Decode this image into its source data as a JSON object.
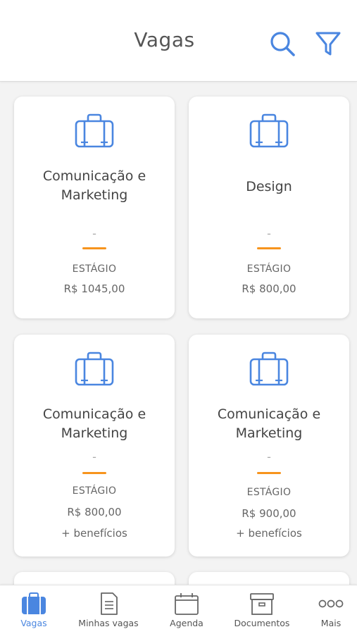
{
  "header": {
    "title": "Vagas",
    "search_icon": "search-icon",
    "filter_icon": "filter-icon"
  },
  "colors": {
    "primary": "#4a86e0",
    "accent": "#f7941d",
    "background": "#f3f3f3"
  },
  "jobs": [
    {
      "title_line1": "Comunicação e",
      "title_line2": "Marketing",
      "area": "-",
      "type": "ESTÁGIO",
      "salary": "R$ 1045,00",
      "benefits": ""
    },
    {
      "title_line1": "Design",
      "title_line2": "",
      "area": "-",
      "type": "ESTÁGIO",
      "salary": "R$ 800,00",
      "benefits": ""
    },
    {
      "title_line1": "Comunicação e",
      "title_line2": "Marketing",
      "area": "-",
      "type": "ESTÁGIO",
      "salary": "R$ 800,00",
      "benefits": "+ benefícios"
    },
    {
      "title_line1": "Comunicação e",
      "title_line2": "Marketing",
      "area": "-",
      "type": "ESTÁGIO",
      "salary": "R$ 900,00",
      "benefits": "+ benefícios"
    }
  ],
  "nav": {
    "items": [
      {
        "label": "Vagas",
        "icon": "briefcase-icon",
        "active": true
      },
      {
        "label": "Minhas vagas",
        "icon": "document-icon",
        "active": false
      },
      {
        "label": "Agenda",
        "icon": "calendar-icon",
        "active": false
      },
      {
        "label": "Documentos",
        "icon": "archive-box-icon",
        "active": false
      },
      {
        "label": "Mais",
        "icon": "more-icon",
        "active": false
      }
    ]
  }
}
